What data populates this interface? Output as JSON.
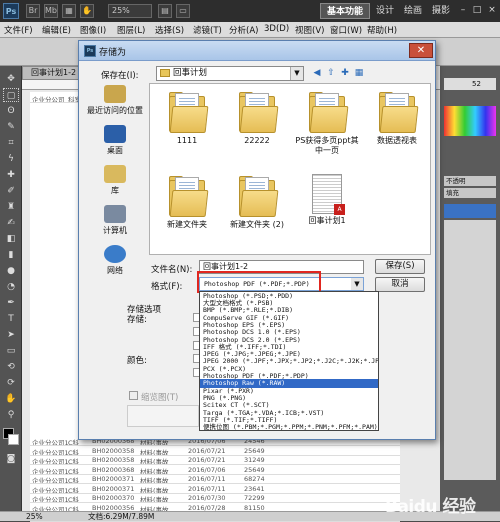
{
  "app": {
    "logo": "Ps",
    "zoom": "25%",
    "workspaces": [
      "基本功能",
      "设计",
      "绘画",
      "摄影"
    ],
    "window_controls": [
      "–",
      "□",
      "×"
    ]
  },
  "menu": [
    "文件(F)",
    "编辑(E)",
    "图像(I)",
    "图层(L)",
    "选择(S)",
    "滤镜(T)",
    "分析(A)",
    "3D(D)",
    "视图(V)",
    "窗口(W)",
    "帮助(H)"
  ],
  "document": {
    "tab": "回事计划1-2 @",
    "rows": [
      [
        "企业分公司1",
        "C科",
        "BH02000368",
        "材料(事故",
        "2016/07/06",
        "24546"
      ],
      [
        "企业分公司1",
        "C科",
        "BH02000358",
        "材料(事故",
        "2016/07/21",
        "25649"
      ],
      [
        "企业分公司1",
        "C科",
        "BH02000358",
        "材料(事故",
        "2016/07/21",
        "31249"
      ],
      [
        "企业分公司1",
        "C科",
        "BH02000368",
        "材料(事故",
        "2016/07/06",
        "25649"
      ],
      [
        "企业分公司1",
        "C科",
        "BH02000371",
        "材料(事故",
        "2016/07/11",
        "68274"
      ],
      [
        "企业分公司1",
        "C科",
        "BH02000371",
        "材料(事故",
        "2016/07/11",
        "23641"
      ],
      [
        "企业分公司1",
        "C科",
        "BH02000370",
        "材料(事故",
        "2016/07/30",
        "72299"
      ],
      [
        "企业分公司1",
        "C科",
        "BH02000356",
        "材料(事故",
        "2016/07/28",
        "81150"
      ],
      [
        "企业分公司1",
        "C科",
        "BH02000358",
        "材料(事故",
        "2016/07/21",
        "78221"
      ]
    ],
    "col_labels": [
      "企业分公司",
      "科室"
    ]
  },
  "panel": {
    "value1": "52",
    "label_fill": "填充",
    "label_opacity": "不透明"
  },
  "status": {
    "zoom": "25%",
    "doc": "文档:6.29M/7.89M"
  },
  "dialog": {
    "title": "存储为",
    "save_in_label": "保存在(I):",
    "save_in_value": "回事计划",
    "places": [
      "最近访问的位置",
      "桌面",
      "库",
      "计算机",
      "网络"
    ],
    "files": [
      "1111",
      "22222",
      "PS获得多页ppt其中一页",
      "数据透视表",
      "新建文件夹",
      "新建文件夹 (2)",
      "回事计划1"
    ],
    "filename_label": "文件名(N):",
    "filename_value": "回事计划1-2",
    "format_label": "格式(F):",
    "format_value": "Photoshop PDF (*.PDF;*.PDP)",
    "save_button": "保存(S)",
    "cancel_button": "取消",
    "options_label": "存储选项",
    "save_label": "存储:",
    "color_label": "颜色:",
    "thumbnail_label": "缩览图(T)",
    "format_options": [
      "Photoshop (*.PSD;*.PDD)",
      "大型文档格式 (*.PSB)",
      "BMP (*.BMP;*.RLE;*.DIB)",
      "CompuServe GIF (*.GIF)",
      "Photoshop EPS (*.EPS)",
      "Photoshop DCS 1.0 (*.EPS)",
      "Photoshop DCS 2.0 (*.EPS)",
      "IFF 格式 (*.IFF;*.TDI)",
      "JPEG (*.JPG;*.JPEG;*.JPE)",
      "JPEG 2000 (*.JPF;*.JPX;*.JP2;*.J2C;*.J2K;*.JPC)",
      "PCX (*.PCX)",
      "Photoshop PDF (*.PDF;*.PDP)",
      "Photoshop Raw (*.RAW)",
      "Pixar (*.PXR)",
      "PNG (*.PNG)",
      "Scitex CT (*.SCT)",
      "Targa (*.TGA;*.VDA;*.ICB;*.VST)",
      "TIFF (*.TIF;*.TIFF)",
      "便携位图 (*.PBM;*.PGM;*.PPM;*.PNM;*.PFM;*.PAM)"
    ],
    "selected_option_index": 12
  },
  "watermark": "Baidu 经验",
  "colors": {
    "highlight": "#3169c6",
    "red_box": "#e0261f"
  }
}
